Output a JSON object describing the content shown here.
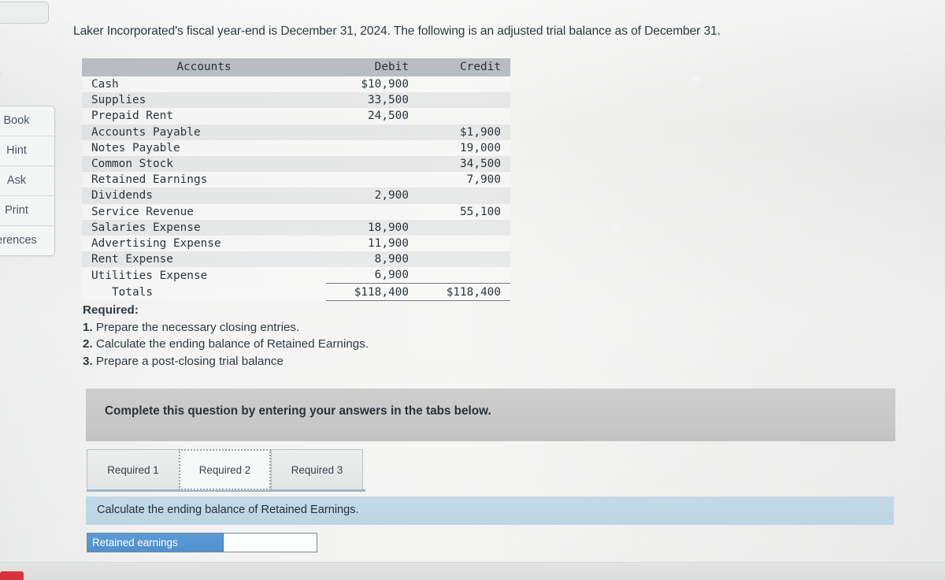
{
  "sidebar": {
    "top_label": "s",
    "items": [
      {
        "name": "ebook",
        "label": "Book"
      },
      {
        "name": "hint",
        "label": "Hint"
      },
      {
        "name": "ask",
        "label": "Ask"
      },
      {
        "name": "print",
        "label": "Print"
      },
      {
        "name": "references",
        "label": "erences"
      }
    ]
  },
  "prompt": {
    "text": "Laker Incorporated's fiscal year-end is December 31, 2024. The following is an adjusted trial balance as of December 31."
  },
  "trial_balance": {
    "columns": [
      "Accounts",
      "Debit",
      "Credit"
    ],
    "rows": [
      {
        "account": "Cash",
        "debit": "$10,900",
        "credit": ""
      },
      {
        "account": "Supplies",
        "debit": "33,500",
        "credit": ""
      },
      {
        "account": "Prepaid Rent",
        "debit": "24,500",
        "credit": ""
      },
      {
        "account": "Accounts Payable",
        "debit": "",
        "credit": "$1,900"
      },
      {
        "account": "Notes Payable",
        "debit": "",
        "credit": "19,000"
      },
      {
        "account": "Common Stock",
        "debit": "",
        "credit": "34,500"
      },
      {
        "account": "Retained Earnings",
        "debit": "",
        "credit": "7,900"
      },
      {
        "account": "Dividends",
        "debit": "2,900",
        "credit": ""
      },
      {
        "account": "Service Revenue",
        "debit": "",
        "credit": "55,100"
      },
      {
        "account": "Salaries Expense",
        "debit": "18,900",
        "credit": ""
      },
      {
        "account": "Advertising Expense",
        "debit": "11,900",
        "credit": ""
      },
      {
        "account": "Rent Expense",
        "debit": "8,900",
        "credit": ""
      },
      {
        "account": "Utilities Expense",
        "debit": "6,900",
        "credit": ""
      }
    ],
    "totals": {
      "account": "Totals",
      "debit": "$118,400",
      "credit": "$118,400"
    }
  },
  "required": {
    "title": "Required:",
    "items": [
      {
        "num": "1.",
        "text": " Prepare the necessary closing entries."
      },
      {
        "num": "2.",
        "text": " Calculate the ending balance of Retained Earnings."
      },
      {
        "num": "3.",
        "text": " Prepare a post-closing trial balance"
      }
    ]
  },
  "complete_banner": {
    "text": "Complete this question by entering your answers in the tabs below."
  },
  "tabs": [
    {
      "label": "Required 1",
      "active": false
    },
    {
      "label": "Required 2",
      "active": true
    },
    {
      "label": "Required 3",
      "active": false
    }
  ],
  "sub_instruction": {
    "text": "Calculate the ending balance of Retained Earnings."
  },
  "answer": {
    "label": "Retained earnings",
    "value": "",
    "placeholder": ""
  },
  "colors": {
    "page_bg": "#e9eaea",
    "table_header_bg": "#b9bdc1",
    "banner_grey": "#c6c7c6",
    "band_blue": "#bcd5e4",
    "answer_label_blue": "#4f91cf",
    "tab_underline": "#9fb6c4",
    "red_marker": "#d8323c"
  }
}
